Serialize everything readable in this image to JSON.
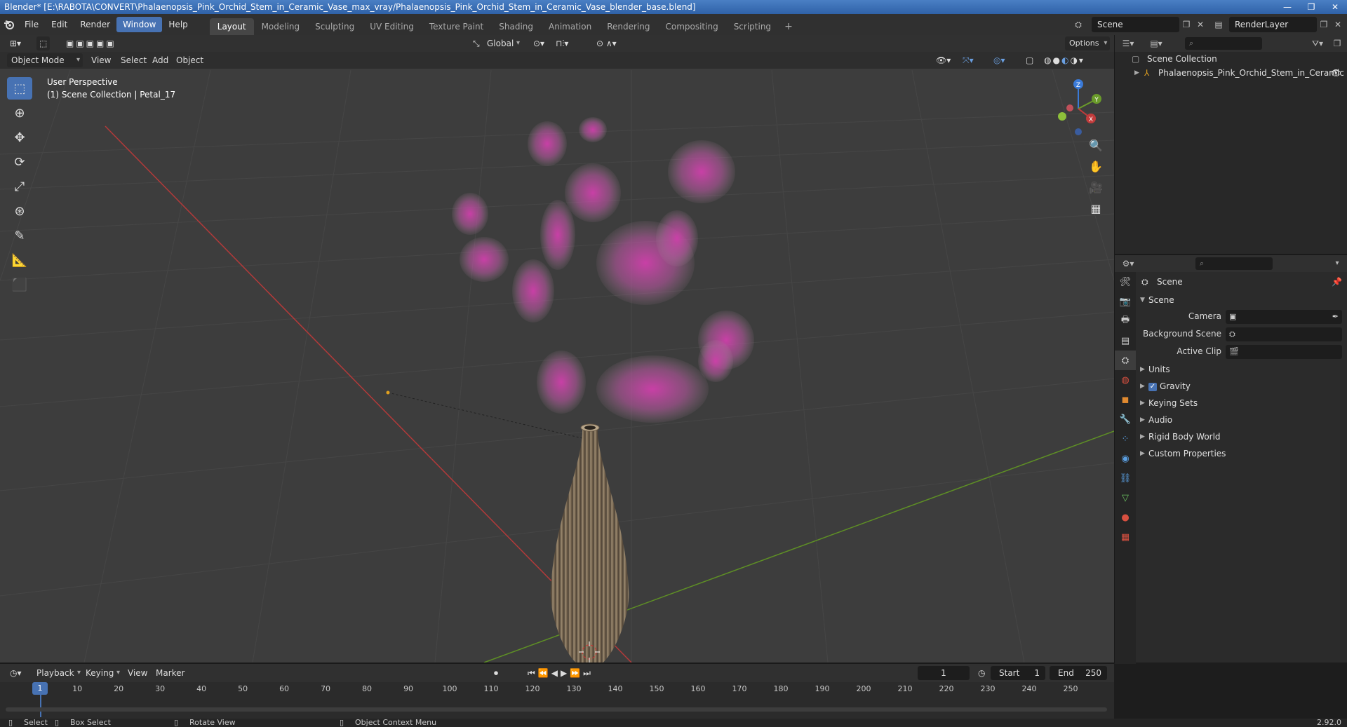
{
  "window": {
    "title": "Blender* [E:\\RABOTA\\CONVERT\\Phalaenopsis_Pink_Orchid_Stem_in_Ceramic_Vase_max_vray/Phalaenopsis_Pink_Orchid_Stem_in_Ceramic_Vase_blender_base.blend]",
    "controls": [
      "—",
      "❐",
      "✕"
    ]
  },
  "menu": [
    "File",
    "Edit",
    "Render",
    "Window",
    "Help"
  ],
  "menu_active": "Window",
  "workspaces": [
    "Layout",
    "Modeling",
    "Sculpting",
    "UV Editing",
    "Texture Paint",
    "Shading",
    "Animation",
    "Rendering",
    "Compositing",
    "Scripting"
  ],
  "workspace_active": "Layout",
  "workspace_add": "+",
  "scene_name": "Scene",
  "render_layer": "RenderLayer",
  "viewport": {
    "mode": "Object Mode",
    "menus": [
      "View",
      "Select",
      "Add",
      "Object"
    ],
    "transform_orientation": "Global",
    "options_label": "Options",
    "perspective_label": "User Perspective",
    "context_label": "(1) Scene Collection | Petal_17",
    "gizmo_axes": {
      "x": "X",
      "y": "Y",
      "z": "Z"
    }
  },
  "outliner": {
    "root": "Scene Collection",
    "items": [
      "Phalaenopsis_Pink_Orchid_Stem_in_Ceramic"
    ]
  },
  "properties": {
    "title": "Scene",
    "panel": "Scene",
    "rows": [
      {
        "label": "Camera",
        "value": ""
      },
      {
        "label": "Background Scene",
        "value": ""
      },
      {
        "label": "Active Clip",
        "value": ""
      }
    ],
    "subpanels": [
      "Units",
      "Gravity",
      "Keying Sets",
      "Audio",
      "Rigid Body World",
      "Custom Properties"
    ],
    "gravity_checked": true
  },
  "timeline": {
    "menus": [
      "Playback",
      "Keying",
      "View",
      "Marker"
    ],
    "current_frame": "1",
    "start_label": "Start",
    "start_value": "1",
    "end_label": "End",
    "end_value": "250",
    "ticks": [
      "1",
      "10",
      "20",
      "30",
      "40",
      "50",
      "60",
      "70",
      "80",
      "90",
      "100",
      "110",
      "120",
      "130",
      "140",
      "150",
      "160",
      "170",
      "180",
      "190",
      "200",
      "210",
      "220",
      "230",
      "240",
      "250"
    ]
  },
  "statusbar": {
    "items": [
      "Select",
      "Box Select",
      "Rotate View",
      "Object Context Menu"
    ],
    "version": "2.92.0"
  },
  "colors": {
    "accent": "#4772b3",
    "viewport_bg": "#3d3d3d",
    "x_axis": "#c23b3b",
    "y_axis": "#6a9b2a",
    "petal": "#d14fb0",
    "vase": "#8c7a62"
  }
}
